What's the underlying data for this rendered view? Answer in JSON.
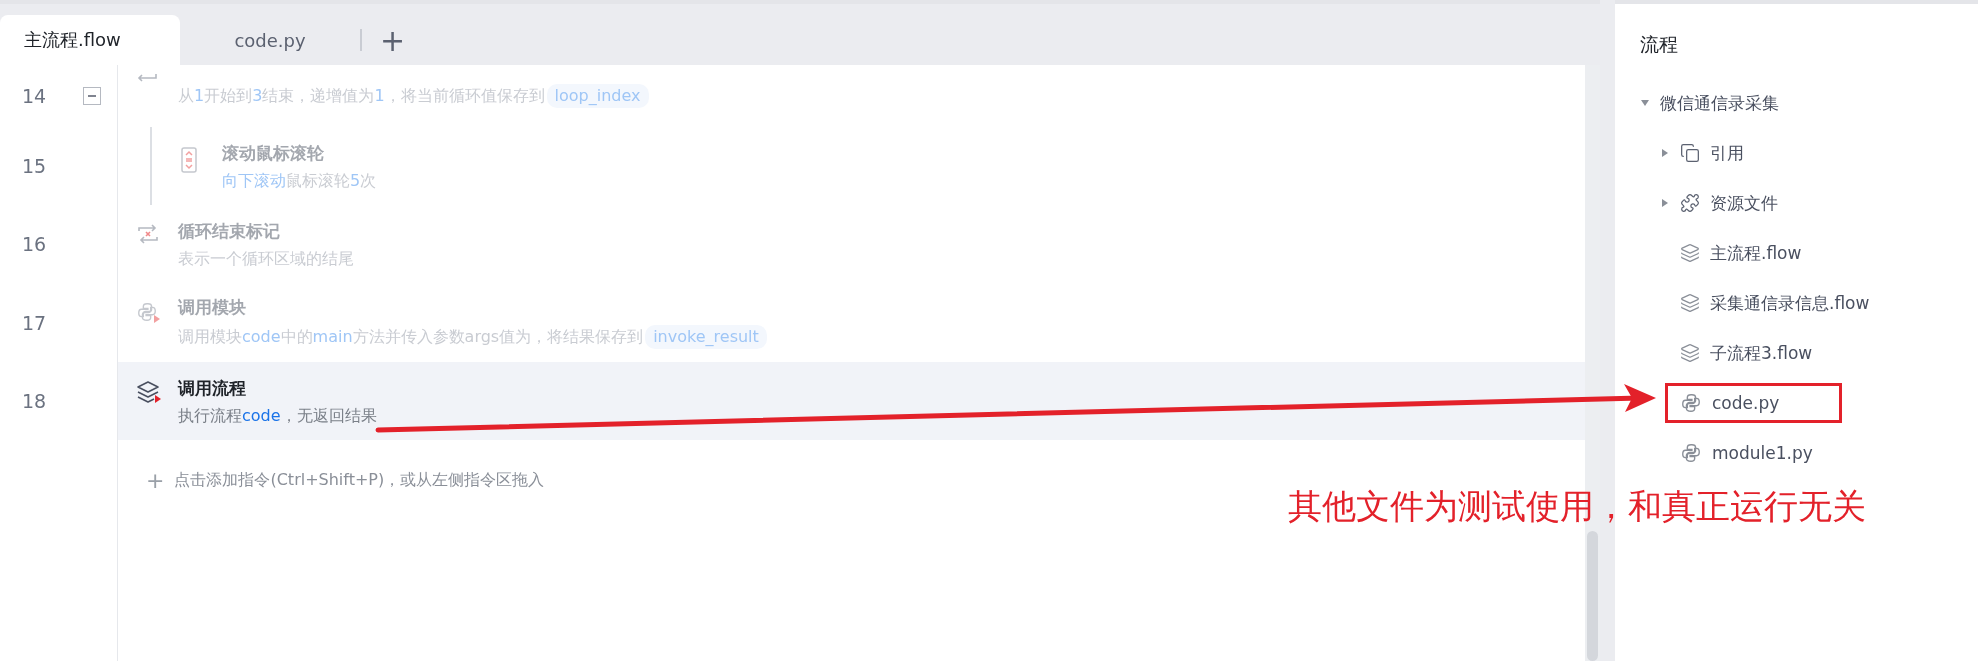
{
  "tabs": [
    {
      "label": "主流程.flow",
      "selected": true
    },
    {
      "label": "code.py",
      "selected": false
    }
  ],
  "add_tab": "+",
  "steps": [
    {
      "line": "14",
      "kind": "loop",
      "disabled": true,
      "selected": false,
      "expanded": true,
      "description": [
        {
          "kind": "text",
          "text": "从"
        },
        {
          "kind": "value",
          "text": "1"
        },
        {
          "kind": "text",
          "text": "开始到"
        },
        {
          "kind": "value",
          "text": "3"
        },
        {
          "kind": "text",
          "text": "结束，递增值为"
        },
        {
          "kind": "value",
          "text": "1"
        },
        {
          "kind": "text",
          "text": "，将当前循环值保存到"
        },
        {
          "kind": "variable",
          "text": "loop_index"
        }
      ],
      "children": [
        {
          "line": "15",
          "kind": "scroll",
          "title": "滚动鼠标滚轮",
          "disabled": true,
          "selected": false,
          "description": [
            {
              "kind": "value",
              "text": "向下滚动"
            },
            {
              "kind": "text",
              "text": "鼠标滚轮"
            },
            {
              "kind": "value",
              "text": "5"
            },
            {
              "kind": "text",
              "text": "次"
            }
          ]
        }
      ]
    },
    {
      "line": "16",
      "kind": "loop_end",
      "title": "循环结束标记",
      "disabled": true,
      "selected": false,
      "description": [
        {
          "kind": "text",
          "text": "表示一个循环区域的结尾"
        }
      ]
    },
    {
      "line": "17",
      "kind": "module",
      "title": "调用模块",
      "disabled": true,
      "selected": false,
      "description": [
        {
          "kind": "text",
          "text": "调用模块"
        },
        {
          "kind": "value",
          "text": "code"
        },
        {
          "kind": "text",
          "text": "中的"
        },
        {
          "kind": "value",
          "text": "main"
        },
        {
          "kind": "text",
          "text": "方法并传入参数args值为，将结果保存到"
        },
        {
          "kind": "variable",
          "text": "invoke_result"
        }
      ]
    },
    {
      "line": "18",
      "kind": "flow",
      "title": "调用流程",
      "disabled": false,
      "selected": true,
      "description": [
        {
          "kind": "text",
          "text": "执行流程"
        },
        {
          "kind": "value",
          "text": "code"
        },
        {
          "kind": "text",
          "text": "，无返回结果"
        }
      ]
    }
  ],
  "add_icon": "+",
  "add_hint": "点击添加指令(Ctrl+Shift+P)，或从左侧指令区拖入",
  "panel": {
    "title": "流程",
    "tree": [
      {
        "label": "微信通信录采集",
        "expanded": true,
        "children": [
          {
            "label": "引用",
            "kind": "reference",
            "expanded": false,
            "marked": false
          },
          {
            "label": "资源文件",
            "kind": "resource",
            "expanded": false,
            "marked": false
          },
          {
            "label": "主流程.flow",
            "kind": "flow",
            "marked": false
          },
          {
            "label": "采集通信录信息.flow",
            "kind": "flow",
            "marked": false
          },
          {
            "label": "子流程3.flow",
            "kind": "flow",
            "marked": false
          },
          {
            "label": "code.py",
            "kind": "python",
            "marked": true
          },
          {
            "label": "module1.py",
            "kind": "python",
            "marked": false
          }
        ]
      }
    ]
  },
  "annotation": {
    "text": "其他文件为测试使用，和真正运行无关"
  }
}
